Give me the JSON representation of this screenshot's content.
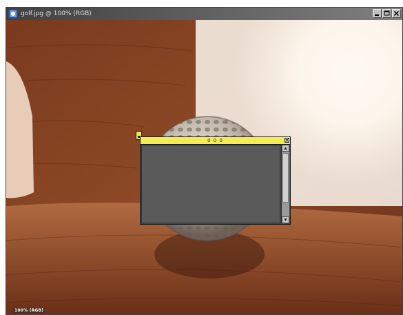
{
  "window": {
    "title": "golf.jpg @ 100% (RGB)",
    "icon": "photoshop-document-icon"
  },
  "canvas": {
    "image": "golf-ball-on-wooden-table-photo",
    "zoom_readout": "100% (RGB)"
  },
  "palette": {
    "title": "0 0 0",
    "scroll_position": 0.1
  },
  "colors": {
    "palette_titlebar": "#f5ec55",
    "palette_body": "#5a5a5a",
    "window_titlebar": "#404040"
  }
}
